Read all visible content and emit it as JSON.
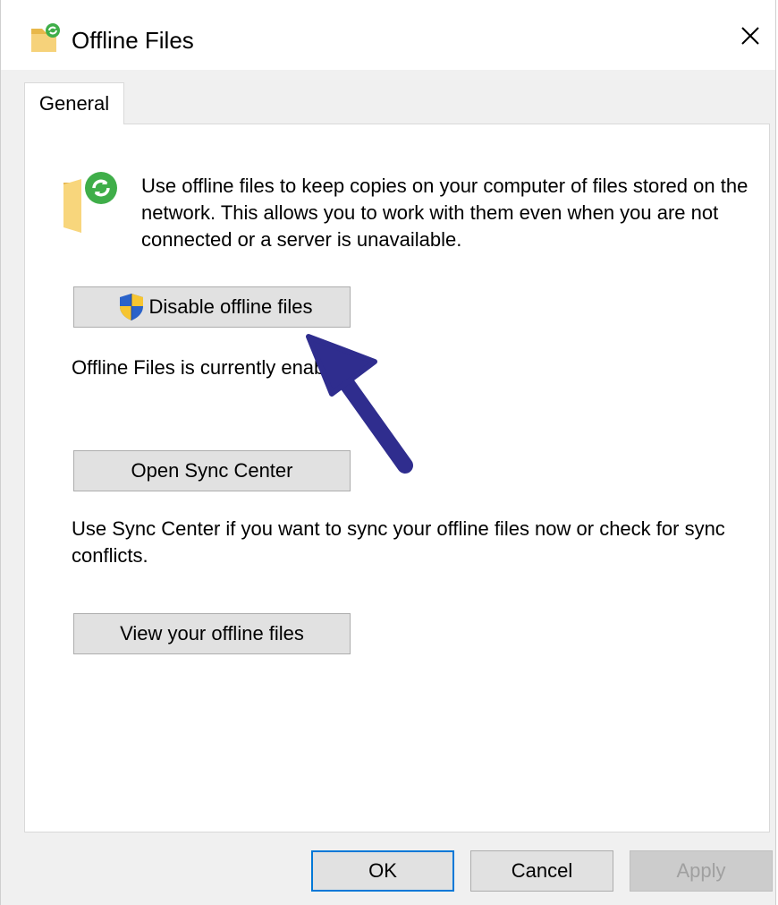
{
  "window": {
    "title": "Offline Files",
    "close_symbol": "✕"
  },
  "tabs": [
    {
      "label": "General",
      "selected": true
    }
  ],
  "general": {
    "description": "Use offline files to keep copies on your computer of files stored on the network.  This allows you to work with them even when you are not connected or a server is unavailable.",
    "disable_button_label": "Disable offline files",
    "status_text": "Offline Files is currently enabled.",
    "open_sync_center_label": "Open Sync Center",
    "sync_center_description": "Use Sync Center if you want to sync your offline files now or check for sync conflicts.",
    "view_offline_files_label": "View your offline files"
  },
  "footer": {
    "ok_label": "OK",
    "cancel_label": "Cancel",
    "apply_label": "Apply",
    "apply_enabled": false
  },
  "icons": {
    "title": "offline-files-icon",
    "header": "offline-folder-sync-icon",
    "shield": "uac-shield-icon",
    "arrow": "annotation-arrow"
  },
  "colors": {
    "arrow": "#2f2d8e",
    "default_button_border": "#0078d7",
    "sync_green": "#3fae49"
  }
}
